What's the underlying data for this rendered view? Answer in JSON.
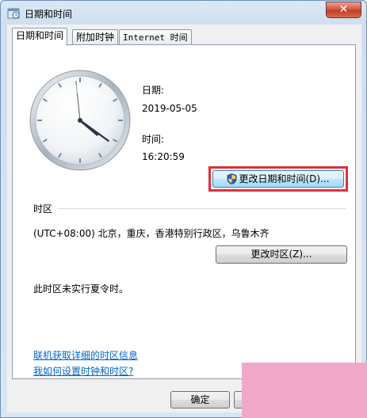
{
  "window": {
    "title": "日期和时间",
    "close_glyph": "✕"
  },
  "tabs": [
    {
      "label": "日期和时间",
      "active": true
    },
    {
      "label": "附加时钟",
      "active": false
    },
    {
      "label": "Internet 时间",
      "active": false
    }
  ],
  "datetime": {
    "date_label": "日期:",
    "date_value": "2019-05-05",
    "time_label": "时间:",
    "time_value": "16:20:59",
    "change_button": "更改日期和时间(D)..."
  },
  "timezone": {
    "section_label": "时区",
    "value": "(UTC+08:00) 北京，重庆，香港特别行政区，乌鲁木齐",
    "change_button": "更改时区(Z)...",
    "dst_note": "此时区未实行夏令时。"
  },
  "links": {
    "online_info": "联机获取详细的时区信息",
    "how_to": "我如何设置时钟和时区?"
  },
  "footer": {
    "ok_button": "确定"
  },
  "icons": {
    "title": "clock-window-icon",
    "shield": "uac-shield-icon"
  },
  "colors": {
    "highlight": "#e0303a",
    "link": "#0066cc",
    "watermark": "#f0a8c8"
  }
}
